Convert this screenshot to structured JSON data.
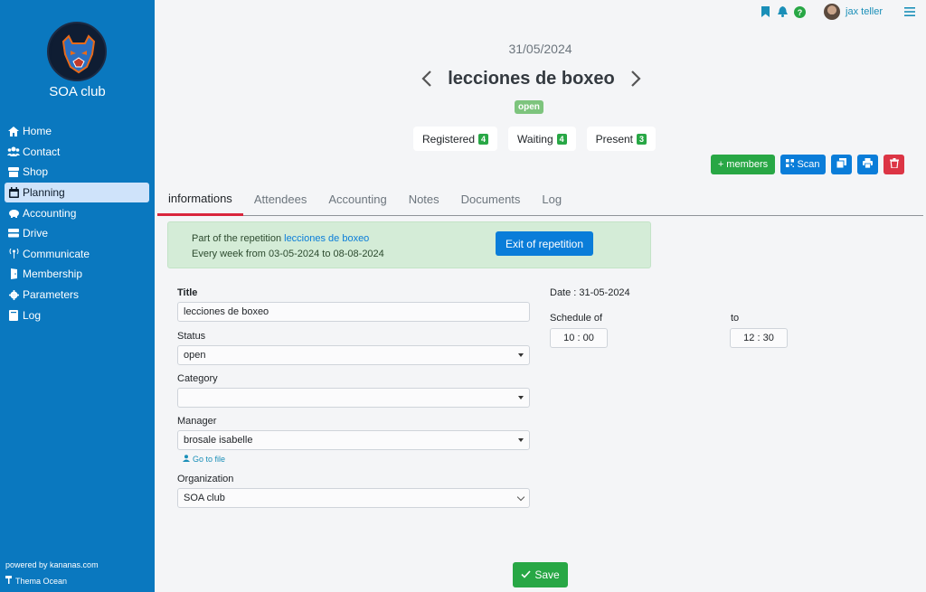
{
  "sidebar": {
    "club_name": "SOA club",
    "items": [
      {
        "label": "Home",
        "icon": "home-icon"
      },
      {
        "label": "Contact",
        "icon": "users-icon"
      },
      {
        "label": "Shop",
        "icon": "store-icon"
      },
      {
        "label": "Planning",
        "icon": "calendar-icon",
        "active": true
      },
      {
        "label": "Accounting",
        "icon": "piggy-bank-icon"
      },
      {
        "label": "Drive",
        "icon": "drive-icon"
      },
      {
        "label": "Communicate",
        "icon": "broadcast-icon"
      },
      {
        "label": "Membership",
        "icon": "door-icon"
      },
      {
        "label": "Parameters",
        "icon": "gear-icon"
      },
      {
        "label": "Log",
        "icon": "book-icon"
      }
    ],
    "powered": "powered by kananas.com",
    "theme": "Thema Ocean"
  },
  "topbar": {
    "user": "jax teller"
  },
  "event": {
    "date": "31/05/2024",
    "title": "lecciones de boxeo",
    "status": "open"
  },
  "counters": [
    {
      "label": "Registered",
      "count": "4"
    },
    {
      "label": "Waiting",
      "count": "4"
    },
    {
      "label": "Present",
      "count": "3"
    }
  ],
  "actions": {
    "members": "+ members",
    "scan": "Scan"
  },
  "tabs": [
    "informations",
    "Attendees",
    "Accounting",
    "Notes",
    "Documents",
    "Log"
  ],
  "repetition": {
    "prefix": "Part of the repetition ",
    "link": "lecciones de boxeo",
    "schedule": "Every week from 03-05-2024 to 08-08-2024",
    "exit": "Exit of repetition"
  },
  "form": {
    "title_label": "Title",
    "title_value": "lecciones de boxeo",
    "status_label": "Status",
    "status_value": "open",
    "category_label": "Category",
    "category_value": "",
    "manager_label": "Manager",
    "manager_value": "brosale isabelle",
    "goto": "Go to file",
    "org_label": "Organization",
    "org_value": "SOA club",
    "date_text": "Date : 31-05-2024",
    "schedule_label": "Schedule of",
    "schedule_from": "10 : 00",
    "to_label": "to",
    "schedule_to": "12 : 30"
  },
  "save": "Save",
  "colors": {
    "sidebar": "#0a78bf",
    "primary": "#0a7dd9",
    "success": "#28a745",
    "danger": "#dc3545"
  }
}
